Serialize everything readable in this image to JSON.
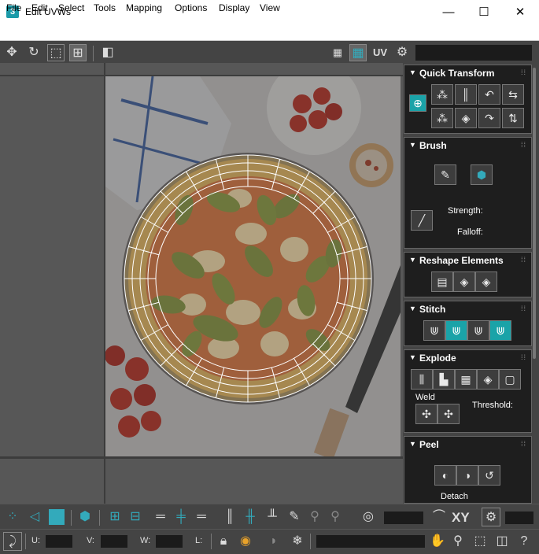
{
  "window": {
    "app_icon_text": "3",
    "title": "Edit UVWs",
    "minimize_glyph": "—",
    "maximize_glyph": "☐",
    "close_glyph": "✕"
  },
  "menu": [
    "File",
    "Edit",
    "Select",
    "Tools",
    "Mapping",
    "Options",
    "Display",
    "View"
  ],
  "toolbar": {
    "uv_label": "UV",
    "icons": [
      "move-icon",
      "rotate-icon",
      "scale-icon",
      "freeform-icon",
      "mirror-icon",
      "checker-icon",
      "texture-toggle-icon",
      "uv-icon",
      "settings-icon"
    ]
  },
  "rollouts": {
    "quick_transform": {
      "title": "Quick Transform"
    },
    "brush": {
      "title": "Brush",
      "strength_label": "Strength:",
      "falloff_label": "Falloff:"
    },
    "reshape": {
      "title": "Reshape Elements"
    },
    "stitch": {
      "title": "Stitch"
    },
    "explode": {
      "title": "Explode",
      "weld_label": "Weld",
      "threshold_label": "Threshold:"
    },
    "peel": {
      "title": "Peel",
      "detach_label": "Detach"
    }
  },
  "bottom": {
    "xy_label": "XY",
    "u_label": "U:",
    "v_label": "V:",
    "w_label": "W:",
    "l_label": "L:"
  },
  "colors": {
    "accent": "#1aa3a8",
    "panel_bg": "#1e1e1e",
    "ui_bg": "#444444"
  }
}
